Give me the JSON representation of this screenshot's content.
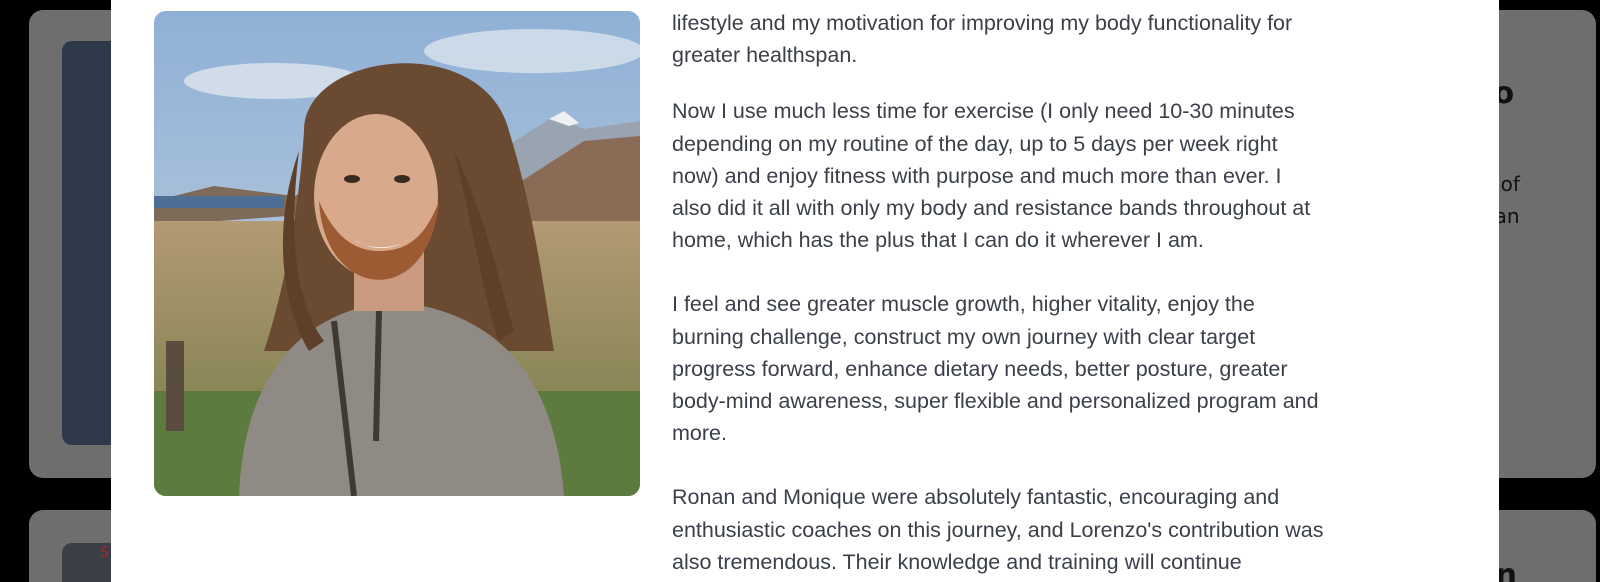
{
  "background": {
    "heading_fragment_1": "zo",
    "text_fragment_1": "e of",
    "text_fragment_2": "han",
    "red_fragment": "S",
    "heading_fragment_2": "on"
  },
  "modal": {
    "photo_alt": "Smiling man with long hair and beard wearing grey hoodie outdoors with mountains",
    "paragraphs": [
      "lifestyle and my motivation for improving my body functionality for\ngreater healthspan.",
      "Now I use much less time for exercise (I only need 10-30 minutes\ndepending on my routine of the day, up to 5 days per week right\nnow) and enjoy fitness with purpose and much more than ever. I\nalso did it all with only my body and resistance bands throughout at\nhome, which has the plus that I can do it wherever I am.",
      "I feel and see greater muscle growth, higher vitality, enjoy the\nburning challenge, construct my own journey with clear target\nprogress forward, enhance dietary needs, better posture, greater\nbody-mind awareness, super flexible and personalized program and\nmore.",
      "Ronan and Monique were absolutely fantastic, encouraging and\nenthusiastic coaches on this journey, and Lorenzo's contribution was\nalso tremendous. Their knowledge and training will continue"
    ]
  },
  "scrollbar": {
    "up_arrow": "▲"
  }
}
